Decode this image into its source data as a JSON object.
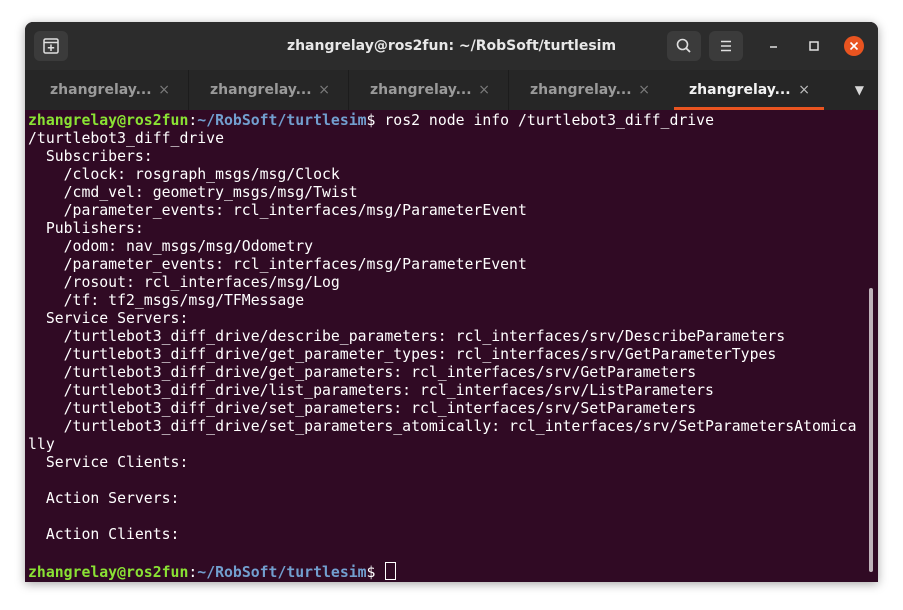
{
  "window": {
    "title": "zhangrelay@ros2fun: ~/RobSoft/turtlesim"
  },
  "tabs": [
    {
      "label": "zhangrelay...",
      "close": "×",
      "active": false
    },
    {
      "label": "zhangrelay...",
      "close": "×",
      "active": false
    },
    {
      "label": "zhangrelay...",
      "close": "×",
      "active": false
    },
    {
      "label": "zhangrelay...",
      "close": "×",
      "active": false
    },
    {
      "label": "zhangrelay...",
      "close": "×",
      "active": true
    }
  ],
  "tab_menu_glyph": "▼",
  "terminal": {
    "prompt_user": "zhangrelay@ros2fun",
    "prompt_colon": ":",
    "prompt_path": "~/RobSoft/turtlesim",
    "prompt_symbol": "$ ",
    "command": "ros2 node info /turtlebot3_diff_drive",
    "output": [
      "/turtlebot3_diff_drive",
      "  Subscribers:",
      "    /clock: rosgraph_msgs/msg/Clock",
      "    /cmd_vel: geometry_msgs/msg/Twist",
      "    /parameter_events: rcl_interfaces/msg/ParameterEvent",
      "  Publishers:",
      "    /odom: nav_msgs/msg/Odometry",
      "    /parameter_events: rcl_interfaces/msg/ParameterEvent",
      "    /rosout: rcl_interfaces/msg/Log",
      "    /tf: tf2_msgs/msg/TFMessage",
      "  Service Servers:",
      "    /turtlebot3_diff_drive/describe_parameters: rcl_interfaces/srv/DescribeParameters",
      "    /turtlebot3_diff_drive/get_parameter_types: rcl_interfaces/srv/GetParameterTypes",
      "    /turtlebot3_diff_drive/get_parameters: rcl_interfaces/srv/GetParameters",
      "    /turtlebot3_diff_drive/list_parameters: rcl_interfaces/srv/ListParameters",
      "    /turtlebot3_diff_drive/set_parameters: rcl_interfaces/srv/SetParameters",
      "    /turtlebot3_diff_drive/set_parameters_atomically: rcl_interfaces/srv/SetParametersAtomica",
      "lly",
      "  Service Clients:",
      "",
      "  Action Servers:",
      "",
      "  Action Clients:",
      ""
    ]
  },
  "colors": {
    "terminal_bg": "#300a24",
    "prompt_user": "#8ae234",
    "prompt_path": "#729fcf",
    "active_tab_accent": "#e95420",
    "close_button": "#e95420"
  },
  "icons": {
    "new_tab": "new-tab-icon",
    "search": "search-icon",
    "menu": "hamburger-menu-icon",
    "minimize": "minimize-icon",
    "maximize": "maximize-icon",
    "close": "close-icon"
  }
}
